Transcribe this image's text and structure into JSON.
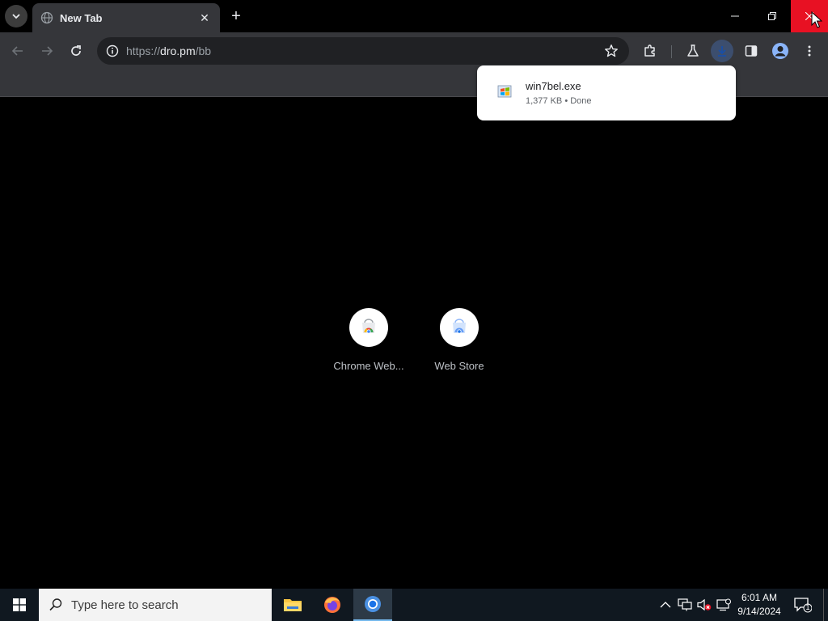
{
  "browser": {
    "tab": {
      "title": "New Tab",
      "close_symbol": "✕"
    },
    "new_tab_symbol": "+",
    "omnibox": {
      "url_scheme": "https://",
      "url_host": "dro.pm",
      "url_path": "/bb"
    },
    "download": {
      "filename": "win7bel.exe",
      "status": "1,377 KB • Done"
    },
    "shortcuts": [
      {
        "label": "Chrome Web...",
        "icon": "chrome-web-store-icon"
      },
      {
        "label": "Web Store",
        "icon": "web-store-icon"
      }
    ]
  },
  "taskbar": {
    "search_placeholder": "Type here to search",
    "apps": [
      "file-explorer-icon",
      "firefox-icon",
      "chrome-icon"
    ],
    "clock_time": "6:01 AM",
    "clock_date": "9/14/2024",
    "notification_count": "1"
  },
  "colors": {
    "tab_active": "#35363a",
    "toolbar": "#35363a",
    "omnibox": "#202124",
    "close_red": "#e81123",
    "taskbar": "#101820"
  }
}
